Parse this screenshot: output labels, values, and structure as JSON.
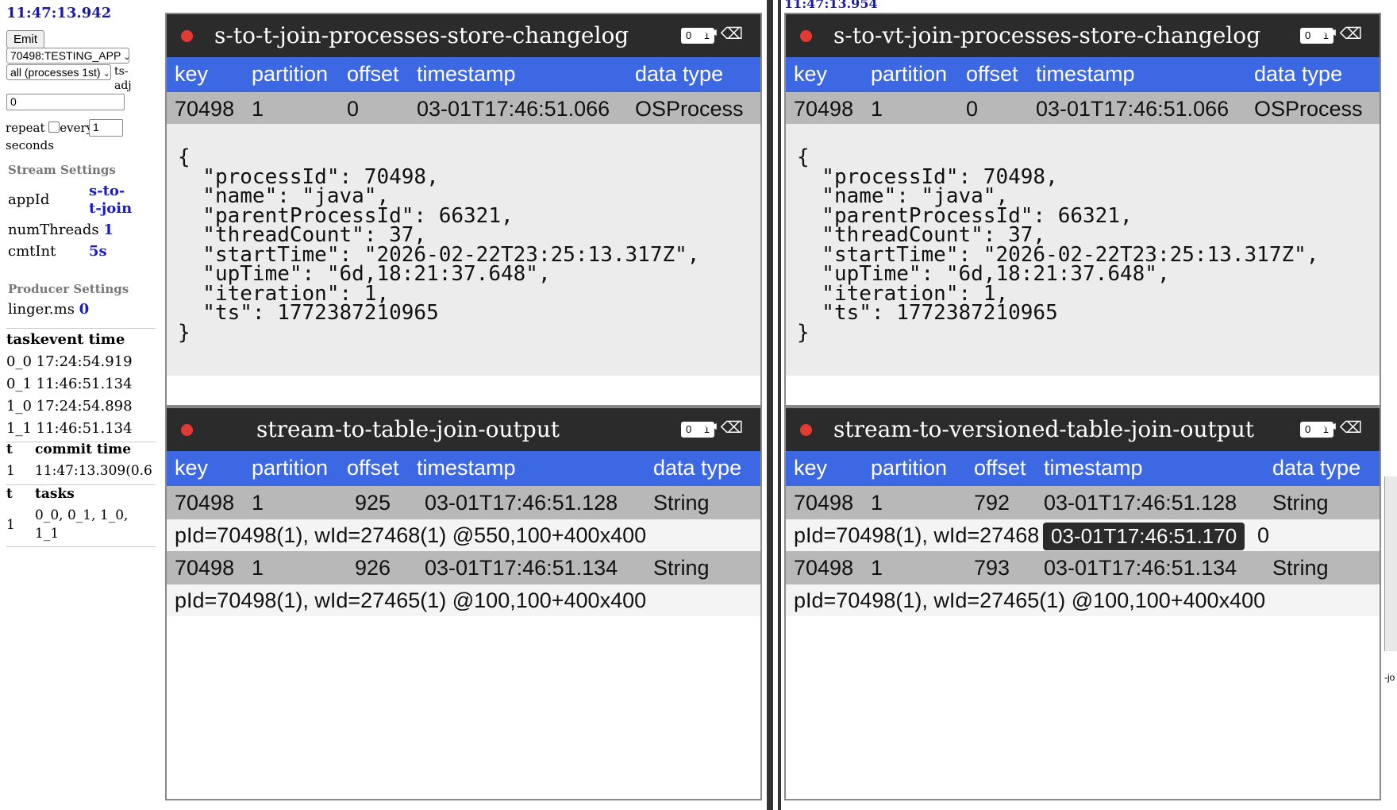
{
  "sidebar": {
    "clock": "11:47:13.942",
    "emit_button": "Emit",
    "process_select": "70498:TESTING_APP",
    "filter_select": "all (processes 1st)",
    "ts_adj_label": "ts-adj",
    "ts_adj_value": "0",
    "repeat_label": "repeat",
    "every_label": "every",
    "every_value": "1",
    "seconds_label": "seconds",
    "stream_settings": {
      "heading": "Stream Settings",
      "appId_label": "appId",
      "appId_value": "s-to-t-join",
      "numThreads_label": "numThreads",
      "numThreads_value": "1",
      "cmtInt_label": "cmtInt",
      "cmtInt_value": "5s"
    },
    "producer_settings": {
      "heading": "Producer Settings",
      "linger_label": "linger.ms",
      "linger_value": "0"
    },
    "task_table": {
      "header": "taskevent time",
      "rows": [
        "0_0 17:24:54.919",
        "0_1 11:46:51.134",
        "1_0 17:24:54.898",
        "1_1 11:46:51.134"
      ]
    },
    "commit_table": {
      "col1": "t",
      "col2": "commit time",
      "row_t": "1",
      "row_time": "11:47:13.309(0.6"
    },
    "tasks_table": {
      "col1": "t",
      "col2": "tasks",
      "row_t": "1",
      "row_tasks": "0_0, 0_1, 1_0, 1_1"
    }
  },
  "headers": {
    "key": "key",
    "partition": "partition",
    "offset": "offset",
    "timestamp": "timestamp",
    "data_type": "data type"
  },
  "control_zero": "0",
  "control_one": "1",
  "panels": {
    "top_left": {
      "title": "s-to-t-join-processes-store-changelog",
      "row": {
        "key": "70498",
        "partition": "1",
        "offset": "0",
        "timestamp": "03-01T17:46:51.066",
        "type": "OSProcess"
      },
      "json": "{\n  \"processId\": 70498,\n  \"name\": \"java\",\n  \"parentProcessId\": 66321,\n  \"threadCount\": 37,\n  \"startTime\": \"2026-02-22T23:25:13.317Z\",\n  \"upTime\": \"6d,18:21:37.648\",\n  \"iteration\": 1,\n  \"ts\": 1772387210965\n}"
    },
    "top_right": {
      "title": "s-to-vt-join-processes-store-changelog",
      "partial_clock": "11:47:13.954",
      "row": {
        "key": "70498",
        "partition": "1",
        "offset": "0",
        "timestamp": "03-01T17:46:51.066",
        "type": "OSProcess"
      },
      "json": "{\n  \"processId\": 70498,\n  \"name\": \"java\",\n  \"parentProcessId\": 66321,\n  \"threadCount\": 37,\n  \"startTime\": \"2026-02-22T23:25:13.317Z\",\n  \"upTime\": \"6d,18:21:37.648\",\n  \"iteration\": 1,\n  \"ts\": 1772387210965\n}"
    },
    "bottom_left": {
      "title": "stream-to-table-join-output",
      "row1": {
        "key": "70498",
        "partition": "1",
        "offset": "925",
        "timestamp": "03-01T17:46:51.128",
        "type": "String"
      },
      "value1": "pId=70498(1), wId=27468(1) @550,100+400x400",
      "row2": {
        "key": "70498",
        "partition": "1",
        "offset": "926",
        "timestamp": "03-01T17:46:51.134",
        "type": "String"
      },
      "value2": "pId=70498(1), wId=27465(1) @100,100+400x400"
    },
    "bottom_right": {
      "title": "stream-to-versioned-table-join-output",
      "row1": {
        "key": "70498",
        "partition": "1",
        "offset": "792",
        "timestamp": "03-01T17:46:51.128",
        "type": "String"
      },
      "value1": "pId=70498(1), wId=27468",
      "value1_tail": "0",
      "tooltip": "03-01T17:46:51.170",
      "row2": {
        "key": "70498",
        "partition": "1",
        "offset": "793",
        "timestamp": "03-01T17:46:51.134",
        "type": "String"
      },
      "value2": "pId=70498(1), wId=27465(1) @100,100+400x400",
      "edge_label": "-jo"
    }
  },
  "colors": {
    "header_blue": "#3d68e4",
    "title_bar": "#2b2b2b",
    "record_dot": "#e23a35",
    "row_gray": "#b8b8b8",
    "clock_blue": "#1a1aa6"
  }
}
